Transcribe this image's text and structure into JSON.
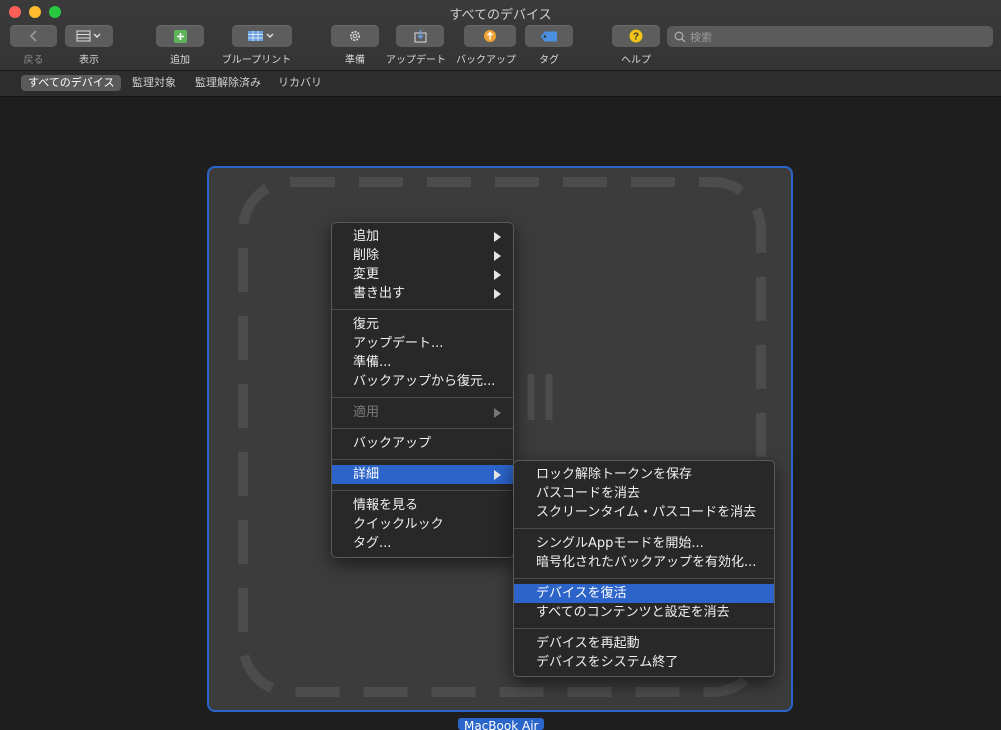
{
  "window": {
    "title": "すべてのデバイス"
  },
  "toolbar": {
    "back": "戻る",
    "view": "表示",
    "add": "追加",
    "blueprint": "ブループリント",
    "prepare": "準備",
    "update": "アップデート",
    "backup": "バックアップ",
    "tag": "タグ",
    "help": "ヘルプ"
  },
  "search": {
    "placeholder": "検索"
  },
  "filters": [
    "すべてのデバイス",
    "監理対象",
    "監理解除済み",
    "リカバリ"
  ],
  "device": {
    "name": "MacBook Air"
  },
  "context_menu": {
    "add": "追加",
    "delete": "削除",
    "change": "変更",
    "export": "書き出す",
    "restore": "復元",
    "update": "アップデート...",
    "prepare": "準備...",
    "restore_from_backup": "バックアップから復元...",
    "apply": "適用",
    "backup": "バックアップ",
    "advanced": "詳細",
    "get_info": "情報を見る",
    "quick_look": "クイックルック",
    "tags": "タグ..."
  },
  "submenu": {
    "save_unlock_token": "ロック解除トークンを保存",
    "erase_passcode": "パスコードを消去",
    "erase_screentime_passcode": "スクリーンタイム・パスコードを消去",
    "start_single_app": "シングルAppモードを開始...",
    "enable_encrypted_backup": "暗号化されたバックアップを有効化...",
    "revive_device": "デバイスを復活",
    "erase_all": "すべてのコンテンツと設定を消去",
    "restart_device": "デバイスを再起動",
    "shutdown_device": "デバイスをシステム終了"
  },
  "colors": {
    "accent": "#2c64c9",
    "background": "#1e1e1e",
    "menu_bg": "#282828"
  }
}
